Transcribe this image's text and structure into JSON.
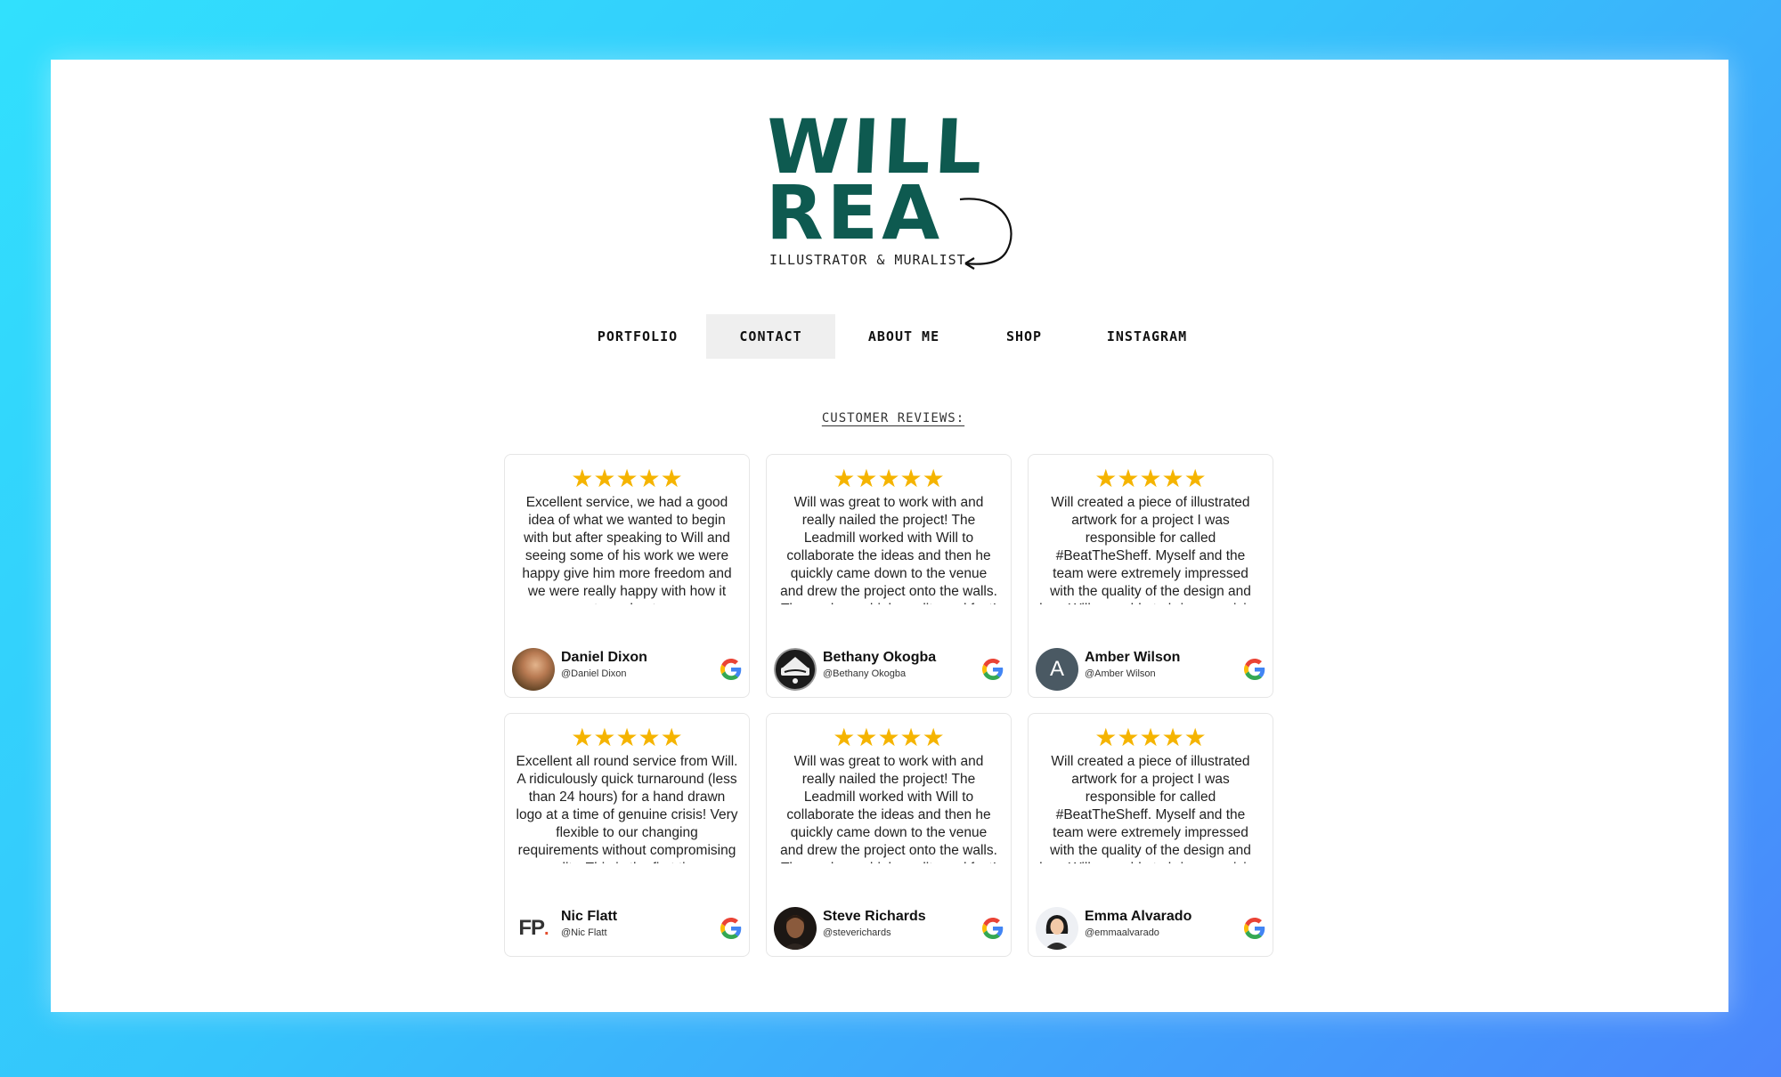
{
  "logo": {
    "line1": "WILL",
    "line2": "REA",
    "tagline": "ILLUSTRATOR & MURALIST"
  },
  "nav": {
    "items": [
      {
        "label": "PORTFOLIO",
        "active": false
      },
      {
        "label": "CONTACT",
        "active": true
      },
      {
        "label": "ABOUT ME",
        "active": false
      },
      {
        "label": "SHOP",
        "active": false
      },
      {
        "label": "INSTAGRAM",
        "active": false
      }
    ]
  },
  "reviews": {
    "heading": "CUSTOMER REVIEWS:",
    "stars": "★★★★★",
    "items": [
      {
        "text": "Excellent service, we had a good idea of what we wanted to begin with but after speaking to Will and seeing some of his work we were happy give him more freedom and we were really happy with how it turned out.",
        "name": "Daniel Dixon",
        "handle": "@Daniel Dixon",
        "avatar": "photo-avatar"
      },
      {
        "text": "Will was great to work with and really nailed the project! The Leadmill worked with Will to collaborate the ideas and then he quickly came down to the venue and drew the project onto the walls. The work was high quality and fast!",
        "name": "Bethany Okogba",
        "handle": "@Bethany Okogba",
        "avatar": "leadmill-avatar"
      },
      {
        "text": "Will created a piece of illustrated artwork for a project I was responsible for called #BeatTheSheff. Myself and the team were extremely impressed with the quality of the design and how Will was able to bring our vision to life!..",
        "name": "Amber Wilson",
        "handle": "@Amber Wilson",
        "avatar": "letter-avatar",
        "avatar_letter": "A"
      },
      {
        "text": "Excellent all round service from Will. A ridiculously quick turnaround (less than 24 hours) for a hand drawn logo at a time of genuine crisis! Very flexible to our changing requirements without compromising on quality. This is the first time we..",
        "name": "Nic Flatt",
        "handle": "@Nic Flatt",
        "avatar": "fp-logo-avatar",
        "avatar_letter": "FP"
      },
      {
        "text": "Will was great to work with and really nailed the project! The Leadmill worked with Will to collaborate the ideas and then he quickly came down to the venue and drew the project onto the walls. The work was high quality and fast!",
        "name": "Steve Richards",
        "handle": "@steverichards",
        "avatar": "photo-avatar"
      },
      {
        "text": "Will created a piece of illustrated artwork for a project I was responsible for called #BeatTheSheff. Myself and the team were extremely impressed with the quality of the design and how Will was able to bring our vision to life!..",
        "name": "Emma Alvarado",
        "handle": "@emmaalvarado",
        "avatar": "illustrated-avatar"
      }
    ]
  },
  "colors": {
    "brand_green": "#0e5a50",
    "star_gold": "#f5b400",
    "nav_active_bg": "#efefef"
  },
  "icons": {
    "review_source": "google-icon"
  }
}
